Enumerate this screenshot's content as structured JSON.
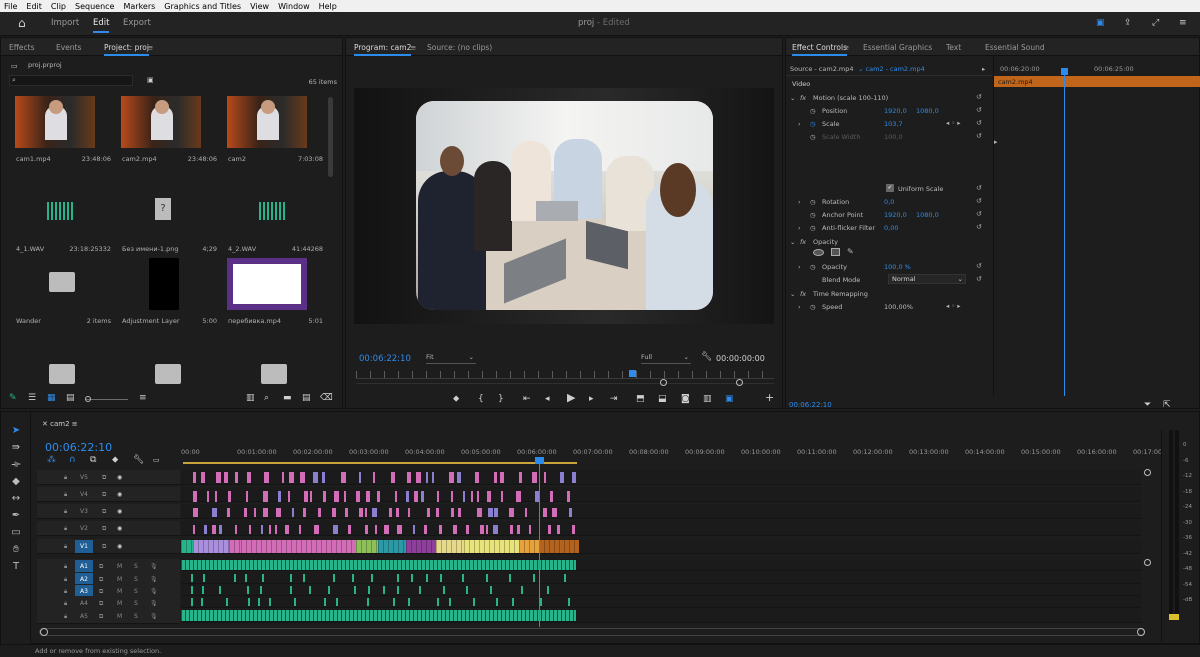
{
  "menubar": {
    "items": [
      "File",
      "Edit",
      "Clip",
      "Sequence",
      "Markers",
      "Graphics and Titles",
      "View",
      "Window",
      "Help"
    ]
  },
  "toolbar": {
    "tabs": [
      "Import",
      "Edit",
      "Export"
    ],
    "project_title": "proj",
    "status": "- Edited"
  },
  "project": {
    "tabs": [
      "Effects",
      "Events",
      "Project: proj"
    ],
    "file_name": "proj.prproj",
    "item_count": "65 items",
    "search_placeholder": "",
    "items": [
      {
        "name": "cam1.mp4",
        "meta": "23:48:06",
        "kind": "video"
      },
      {
        "name": "cam2.mp4",
        "meta": "23:48:06",
        "kind": "video"
      },
      {
        "name": "cam2",
        "meta": "7:03:08",
        "kind": "sequence"
      },
      {
        "name": "4_1.WAV",
        "meta": "23:18:25332",
        "kind": "audio"
      },
      {
        "name": "Без имени-1.png",
        "meta": "4;29",
        "kind": "image"
      },
      {
        "name": "4_2.WAV",
        "meta": "41:44268",
        "kind": "audio"
      },
      {
        "name": "Wander",
        "meta": "2 items",
        "kind": "folder"
      },
      {
        "name": "Adjustment Layer",
        "meta": "5:00",
        "kind": "adjustment"
      },
      {
        "name": "перебивка.mp4",
        "meta": "5:01",
        "kind": "overlay"
      },
      {
        "name": "",
        "meta": "",
        "kind": "folder"
      },
      {
        "name": "",
        "meta": "",
        "kind": "folder"
      },
      {
        "name": "",
        "meta": "",
        "kind": "folder"
      }
    ]
  },
  "program": {
    "tabs": [
      "Program: cam2",
      "Source: (no clips)"
    ],
    "timecode": "00:06:22:10",
    "fit": "Fit",
    "quality": "Full",
    "duration": "00:00:00:00"
  },
  "effect_controls": {
    "tabs": [
      "Effect Controls",
      "Essential Graphics",
      "Text",
      "Essential Sound"
    ],
    "source": "Source - cam2.mp4",
    "clip": "cam2 - cam2.mp4",
    "section_video": "Video",
    "motion_label": "Motion (scale 100-110)",
    "rows": [
      {
        "label": "Position",
        "v1": "1920,0",
        "v2": "1080,0"
      },
      {
        "label": "Scale",
        "v1": "103,7",
        "v2": ""
      },
      {
        "label": "Scale Width",
        "v1": "100,0",
        "v2": ""
      },
      {
        "label": "Rotation",
        "v1": "0,0",
        "v2": ""
      },
      {
        "label": "Anchor Point",
        "v1": "1920,0",
        "v2": "1080,0"
      },
      {
        "label": "Anti-flicker Filter",
        "v1": "0,00",
        "v2": ""
      }
    ],
    "uniform_scale": "Uniform Scale",
    "opacity_label": "Opacity",
    "opacity_value": "100,0 %",
    "blend_label": "Blend Mode",
    "blend_value": "Normal",
    "time_remap": "Time Remapping",
    "speed_label": "Speed",
    "speed_value": "100,00%",
    "ruler": [
      "00:06:20:00",
      "00:06:25:00"
    ],
    "clip_bar": "cam2.mp4",
    "timecode": "00:06:22:10"
  },
  "timeline": {
    "sequence_tab": "cam2",
    "timecode": "00:06:22:10",
    "ruler": [
      "00:00",
      "00:01:00:00",
      "00:02:00:00",
      "00:03:00:00",
      "00:04:00:00",
      "00:05:00:00",
      "00:06:00:00",
      "00:07:00:00",
      "00:08:00:00",
      "00:09:00:00",
      "00:10:00:00",
      "00:11:00:00",
      "00:12:00:00",
      "00:13:00:00",
      "00:14:00:00",
      "00:15:00:00",
      "00:16:00:00",
      "00:17:00"
    ],
    "video_tracks": [
      "V5",
      "V4",
      "V3",
      "V2",
      "V1"
    ],
    "audio_tracks": [
      "A1",
      "A2",
      "A3",
      "A4",
      "A5"
    ],
    "meter_labels": [
      "0",
      "-6",
      "-12",
      "-18",
      "-24",
      "-30",
      "-36",
      "-42",
      "-48",
      "-54",
      "-dB"
    ]
  },
  "status_bar": "Add or remove from existing selection.",
  "colors": {
    "accent": "#2d8ceb",
    "audio_clip": "#27b48a",
    "video_pink": "#d36db8",
    "playhead": "#2d8ceb",
    "ec_clip": "#c0651a"
  }
}
